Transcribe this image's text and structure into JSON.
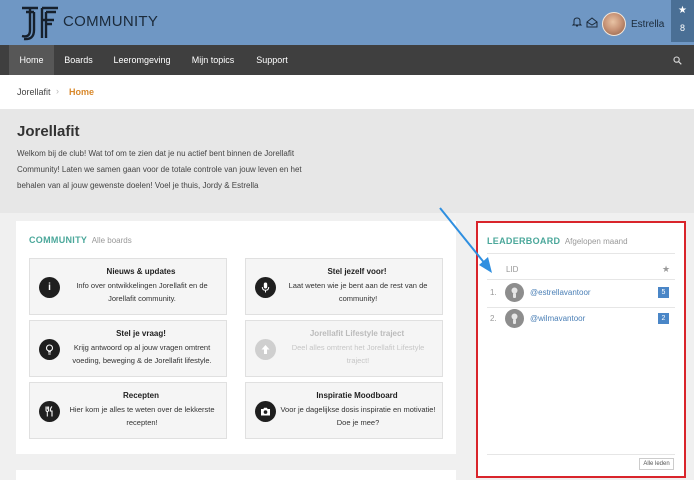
{
  "header": {
    "brand": "COMMUNITY",
    "username": "Estrella",
    "star_count": "8",
    "star_icon": "★",
    "colors": {
      "topbar": "#6f97c4",
      "nav": "#3f3f3f",
      "accent": "#4aa79a",
      "highlight": "#d9242b"
    }
  },
  "nav": {
    "items": [
      "Home",
      "Boards",
      "Leeromgeving",
      "Mijn topics",
      "Support"
    ]
  },
  "breadcrumb": {
    "root": "Jorellafit",
    "separator": "›",
    "current": "Home"
  },
  "hero": {
    "title": "Jorellafit",
    "text": "Welkom bij de club! Wat tof om te zien dat je nu actief bent binnen de Jorellafit Community! Laten we samen gaan voor de totale controle van jouw leven en het behalen van al jouw gewenste doelen! Voel je thuis, Jordy & Estrella"
  },
  "community": {
    "title": "COMMUNITY",
    "subtitle": "Alle boards",
    "boards": [
      {
        "title": "Nieuws & updates",
        "desc": "Info over ontwikkelingen Jorellafit en de Jorellafit community.",
        "icon": "info-icon",
        "glyph": "i",
        "dimmed": false
      },
      {
        "title": "Stel jezelf voor!",
        "desc": "Laat weten wie je bent aan de rest van de community!",
        "icon": "microphone-icon",
        "dimmed": false
      },
      {
        "title": "Stel je vraag!",
        "desc": "Krijg antwoord op al jouw vragen omtrent voeding, beweging & de Jorellafit lifestyle.",
        "icon": "lightbulb-icon",
        "dimmed": false
      },
      {
        "title": "Jorellafit Lifestyle traject",
        "desc": "Deel alles omtrent het Jorellafit Lifestyle traject!",
        "icon": "arrow-up-icon",
        "dimmed": true
      },
      {
        "title": "Recepten",
        "desc": "Hier kom je alles te weten over de lekkerste recepten!",
        "icon": "cutlery-icon",
        "dimmed": false
      },
      {
        "title": "Inspiratie Moodboard",
        "desc": "Voor je dagelijkse dosis inspiratie en motivatie! Doe je mee?",
        "icon": "camera-icon",
        "dimmed": false
      }
    ]
  },
  "leaderboard": {
    "title": "LEADERBOARD",
    "subtitle": "Afgelopen maand",
    "column_member": "LID",
    "column_star": "★",
    "rows": [
      {
        "rank": "1.",
        "name": "@estrellavantoor",
        "score": "5"
      },
      {
        "rank": "2.",
        "name": "@wilmavantoor",
        "score": "2"
      }
    ],
    "all_members_label": "Alle leden"
  }
}
